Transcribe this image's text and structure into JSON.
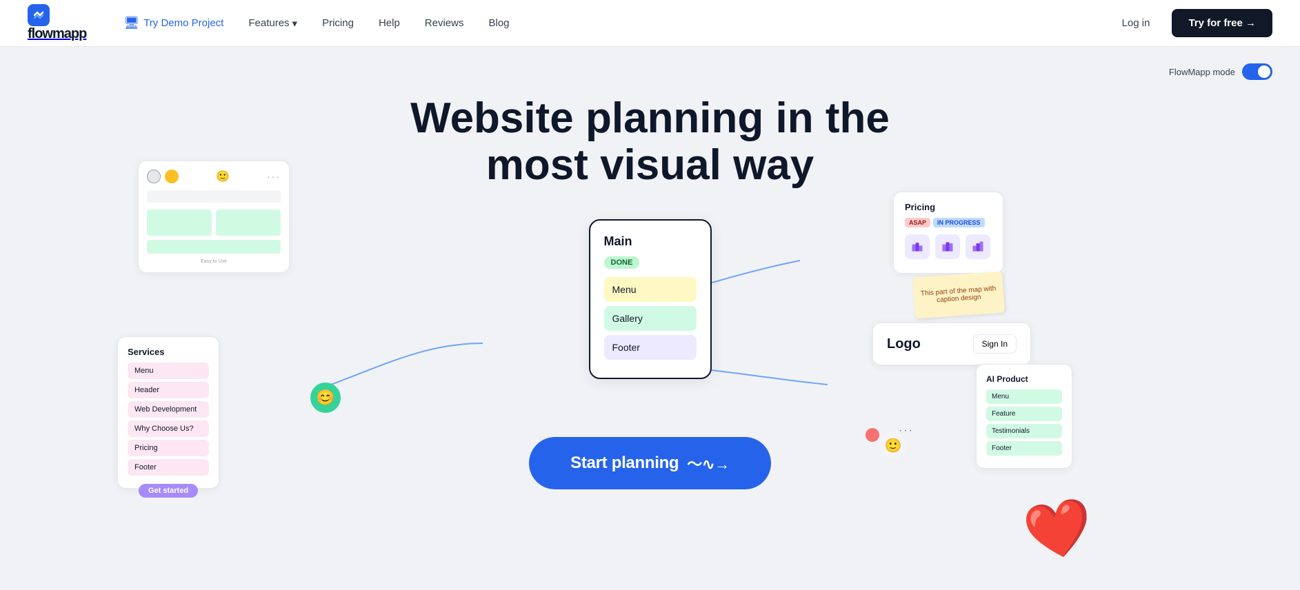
{
  "nav": {
    "logo_text": "flowmapp",
    "logo_icon": "m",
    "demo_label": "Try Demo Project",
    "features_label": "Features",
    "pricing_label": "Pricing",
    "help_label": "Help",
    "reviews_label": "Reviews",
    "blog_label": "Blog",
    "login_label": "Log in",
    "try_label": "Try for free →"
  },
  "mode": {
    "label": "FlowMapp mode"
  },
  "hero": {
    "headline_line1": "Website planning in the",
    "headline_line2": "most visual way",
    "cta_label": "Start planning"
  },
  "card_main": {
    "title": "Main",
    "badge": "DONE",
    "item1": "Menu",
    "item2": "Gallery",
    "item3": "Footer"
  },
  "card_services": {
    "title": "Services",
    "items": [
      "Menu",
      "Header",
      "Web Development",
      "Why Choose Us?",
      "Pricing",
      "Footer"
    ],
    "badge": "Get started"
  },
  "card_pricing": {
    "title": "Pricing",
    "badge1": "ASAP",
    "badge2": "IN PROGRESS"
  },
  "card_logo": {
    "logo_text": "Logo",
    "btn_label": "Sign In"
  },
  "card_ai": {
    "title": "AI Product",
    "items": [
      "Menu",
      "Feature",
      "Testimonials",
      "Footer"
    ]
  },
  "sticky": {
    "text": "This part of the map with caption design"
  }
}
